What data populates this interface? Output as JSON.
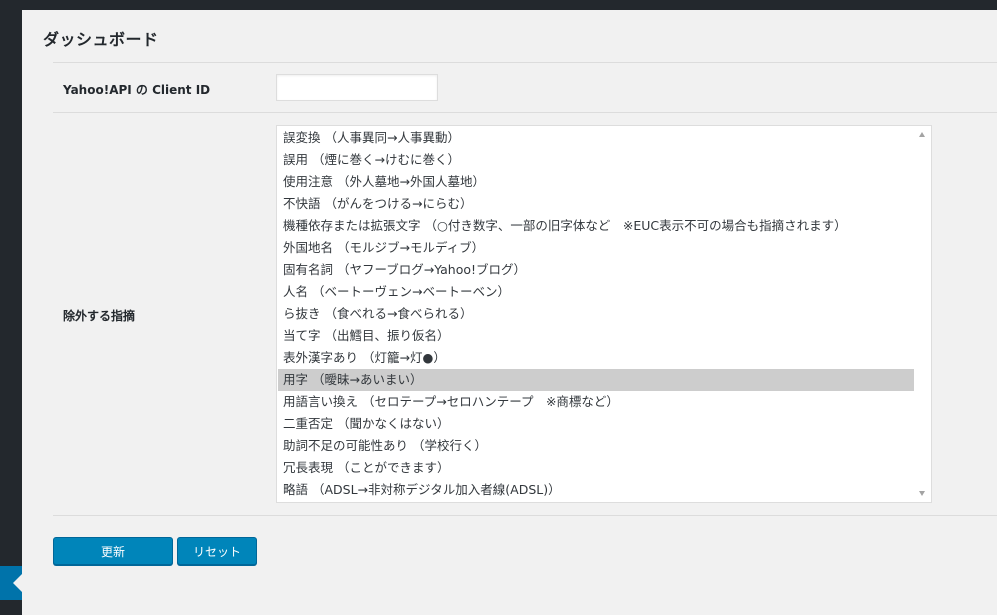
{
  "page": {
    "title": "ダッシュボード"
  },
  "settings": {
    "client_id": {
      "label": "Yahoo!API の Client ID",
      "value": "",
      "placeholder": ""
    },
    "exclusions": {
      "label": "除外する指摘",
      "options": [
        {
          "label": "誤変換 （人事異同→人事異動）",
          "selected": false
        },
        {
          "label": "誤用 （煙に巻く→けむに巻く）",
          "selected": false
        },
        {
          "label": "使用注意 （外人墓地→外国人墓地）",
          "selected": false
        },
        {
          "label": "不快語 （がんをつける→にらむ）",
          "selected": false
        },
        {
          "label": "機種依存または拡張文字 （○付き数字、一部の旧字体など　※EUC表示不可の場合も指摘されます）",
          "selected": false
        },
        {
          "label": "外国地名 （モルジブ→モルディブ）",
          "selected": false
        },
        {
          "label": "固有名詞 （ヤフーブログ→Yahoo!ブログ）",
          "selected": false
        },
        {
          "label": "人名 （ベートーヴェン→ベートーベン）",
          "selected": false
        },
        {
          "label": "ら抜き （食べれる→食べられる）",
          "selected": false
        },
        {
          "label": "当て字 （出鱈目、振り仮名）",
          "selected": false
        },
        {
          "label": "表外漢字あり （灯籠→灯●）",
          "selected": false
        },
        {
          "label": "用字 （曖昧→あいまい）",
          "selected": true
        },
        {
          "label": "用語言い換え （セロテープ→セロハンテープ　※商標など）",
          "selected": false
        },
        {
          "label": "二重否定 （聞かなくはない）",
          "selected": false
        },
        {
          "label": "助詞不足の可能性あり （学校行く）",
          "selected": false
        },
        {
          "label": "冗長表現 （ことができます）",
          "selected": false
        },
        {
          "label": "略語 （ADSL→非対称デジタル加入者線(ADSL)）",
          "selected": false
        }
      ]
    }
  },
  "actions": {
    "update_label": "更新",
    "reset_label": "リセット"
  },
  "colors": {
    "primary": "#0085ba",
    "sidebar": "#23282d",
    "background": "#f1f1f1",
    "selected_option": "#cdcdcd"
  }
}
